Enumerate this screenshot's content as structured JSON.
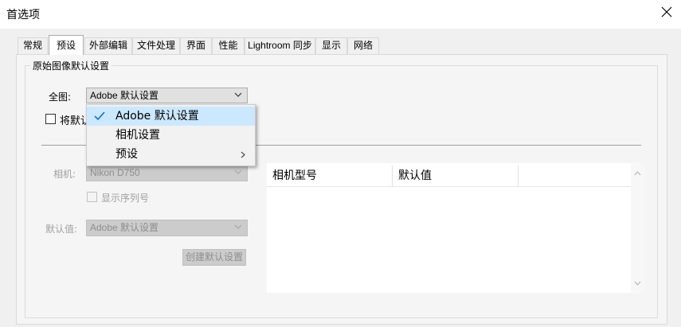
{
  "window": {
    "title": "首选项"
  },
  "tabs": [
    {
      "label": "常规"
    },
    {
      "label": "预设"
    },
    {
      "label": "外部编辑"
    },
    {
      "label": "文件处理"
    },
    {
      "label": "界面"
    },
    {
      "label": "性能"
    },
    {
      "label": "Lightroom 同步"
    },
    {
      "label": "显示"
    },
    {
      "label": "网络"
    }
  ],
  "group": {
    "title": "原始图像默认设置"
  },
  "master": {
    "label": "全图:",
    "value": "Adobe 默认设置"
  },
  "checkbox_override": {
    "label": "将默认"
  },
  "camera": {
    "label": "相机:",
    "value": "Nikon D750",
    "show_serial_label": "显示序列号",
    "default_label": "默认值:",
    "default_value": "Adobe 默认设置",
    "create_button": "创建默认设置"
  },
  "table": {
    "columns": [
      "相机型号",
      "默认值",
      ""
    ]
  },
  "menu": {
    "items": [
      {
        "label": "Adobe 默认设置",
        "checked": true
      },
      {
        "label": "相机设置"
      },
      {
        "label": "预设",
        "submenu": true
      }
    ]
  },
  "colors": {
    "menu_highlight": "#cce8ff",
    "check_blue": "#1a73c7",
    "disabled_text": "#a0a0a0"
  }
}
